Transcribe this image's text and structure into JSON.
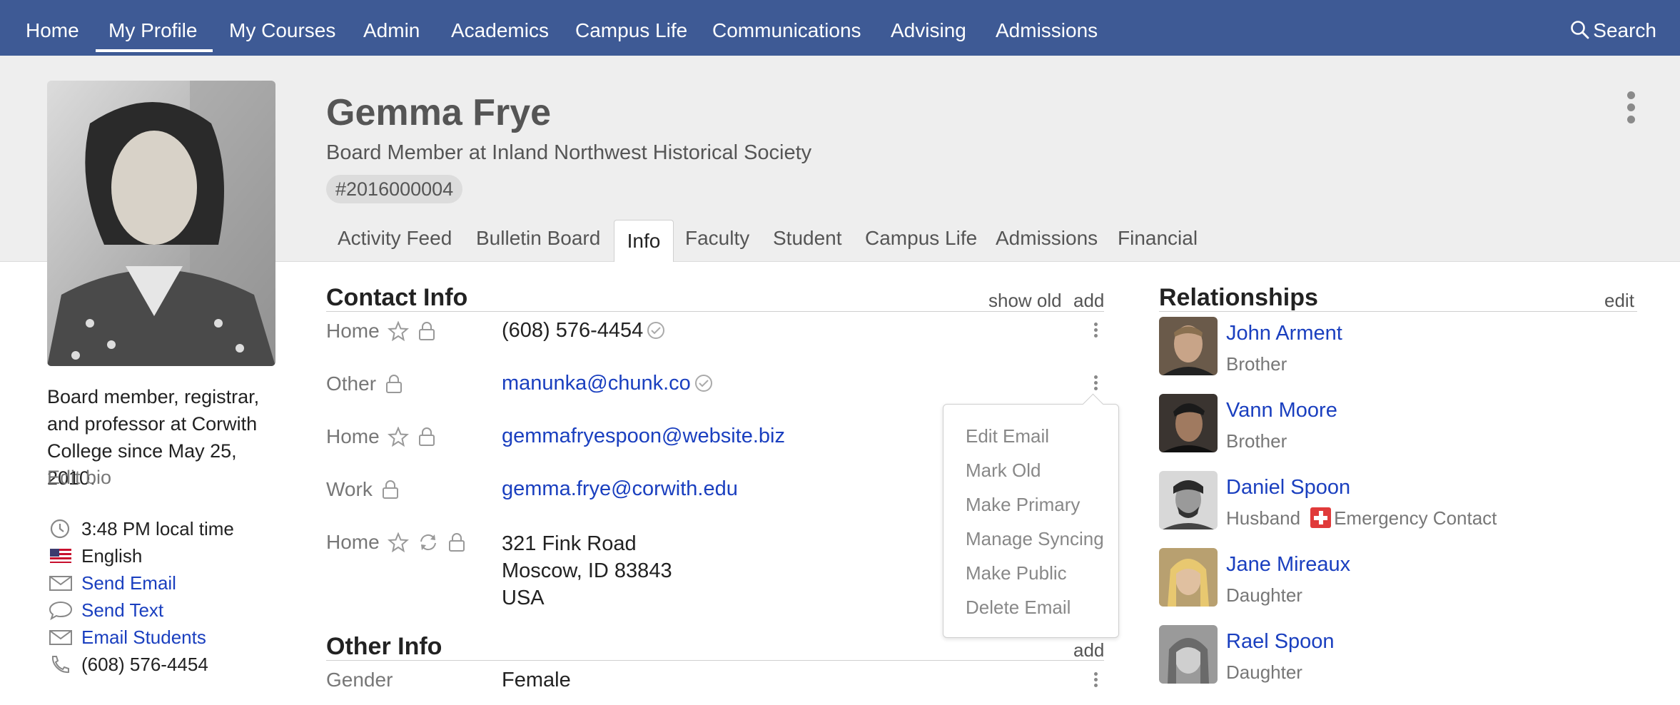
{
  "nav": {
    "items": [
      "Home",
      "My Profile",
      "My Courses",
      "Admin",
      "Academics",
      "Campus Life",
      "Communications",
      "Advising",
      "Admissions"
    ],
    "active": "My Profile",
    "search_label": "Search"
  },
  "profile": {
    "name": "Gemma Frye",
    "subtitle": "Board Member at Inland Northwest Historical Society",
    "id_badge": "#2016000004",
    "bio": "Board member, registrar, and professor at Corwith College since May 25, 2010.",
    "edit_bio": "Edit bio",
    "local_time": "3:48 PM local time",
    "language": "English",
    "send_email": "Send Email",
    "send_text": "Send Text",
    "email_students": "Email Students",
    "phone": "(608) 576-4454"
  },
  "tabs": [
    "Activity Feed",
    "Bulletin Board",
    "Info",
    "Faculty",
    "Student",
    "Campus Life",
    "Admissions",
    "Financial"
  ],
  "active_tab": "Info",
  "contact_info": {
    "title": "Contact Info",
    "show_old": "show old",
    "add": "add",
    "rows": [
      {
        "label": "Home",
        "value": "(608) 576-4454",
        "verified": true,
        "star": true,
        "sync": false
      },
      {
        "label": "Other",
        "value": "manunka@chunk.co",
        "verified": true,
        "star": false,
        "sync": false
      },
      {
        "label": "Home",
        "value": "gemmafryespoon@website.biz",
        "verified": false,
        "star": true,
        "sync": false
      },
      {
        "label": "Work",
        "value": "gemma.frye@corwith.edu",
        "verified": false,
        "star": false,
        "sync": false
      },
      {
        "label": "Home",
        "address": [
          "321 Fink Road",
          "Moscow, ID 83843",
          "USA"
        ],
        "star": true,
        "sync": true
      }
    ]
  },
  "email_menu": [
    "Edit Email",
    "Mark Old",
    "Make Primary",
    "Manage Syncing",
    "Make Public",
    "Delete Email"
  ],
  "other_info": {
    "title": "Other Info",
    "add": "add",
    "rows": [
      {
        "label": "Gender",
        "value": "Female"
      }
    ]
  },
  "relationships": {
    "title": "Relationships",
    "edit": "edit",
    "people": [
      {
        "name": "John Arment",
        "role": "Brother"
      },
      {
        "name": "Vann Moore",
        "role": "Brother"
      },
      {
        "name": "Daniel Spoon",
        "role": "Husband",
        "badge": "Emergency Contact"
      },
      {
        "name": "Jane Mireaux",
        "role": "Daughter"
      },
      {
        "name": "Rael Spoon",
        "role": "Daughter"
      }
    ]
  },
  "colors": {
    "nav_bg": "#3e5a95",
    "link": "#1a3fbf",
    "header_band": "#eeeeee",
    "emergency": "#e03a3a"
  }
}
